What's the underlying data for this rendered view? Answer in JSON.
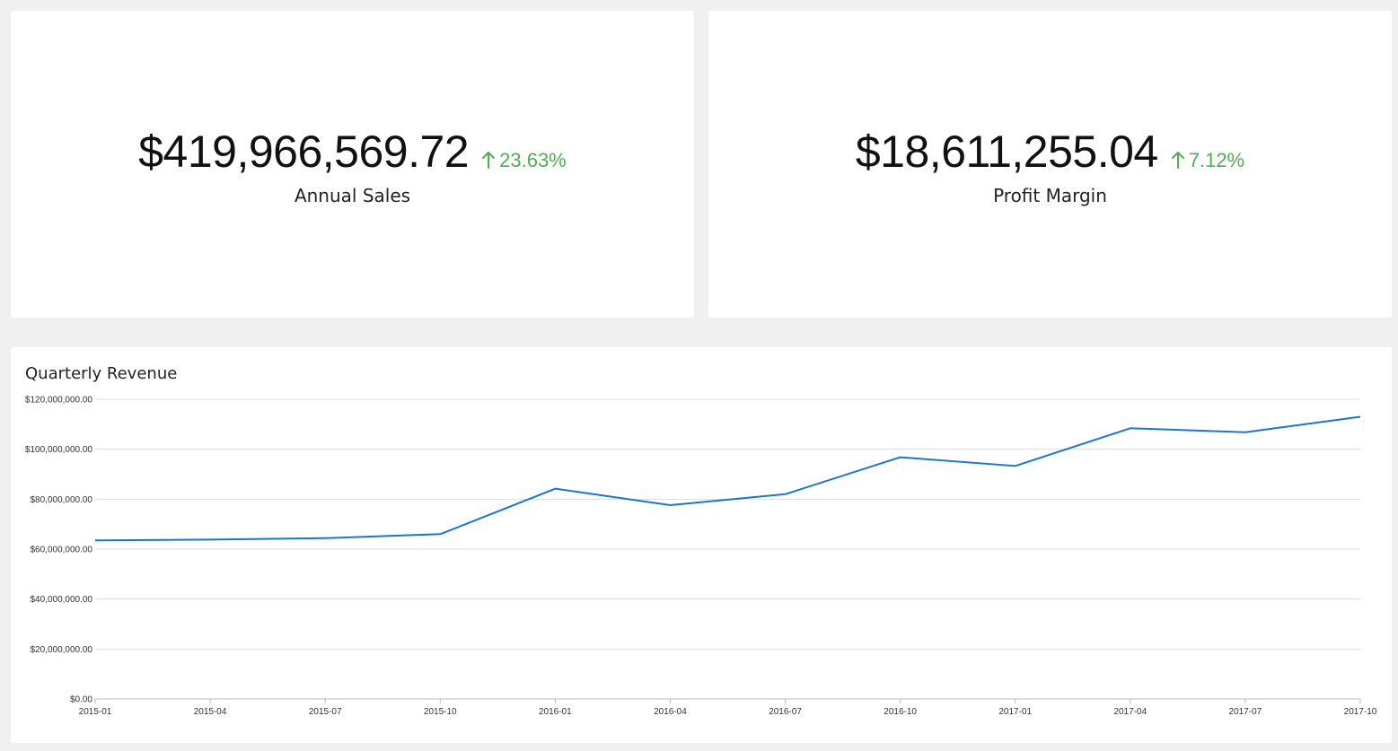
{
  "colors": {
    "background": "#f0f0f0",
    "card": "#ffffff",
    "positive": "#4caf50",
    "line": "#1976d2",
    "grid": "#dddddd"
  },
  "kpis": [
    {
      "value": "$419,966,569.72",
      "delta": "23.63%",
      "delta_icon": "arrow-up-icon",
      "label": "Annual Sales"
    },
    {
      "value": "$18,611,255.04",
      "delta": "7.12%",
      "delta_icon": "arrow-up-icon",
      "label": "Profit Margin"
    }
  ],
  "chart_data": {
    "type": "line",
    "title": "Quarterly Revenue",
    "xlabel": "",
    "ylabel": "",
    "categories": [
      "2015-01",
      "2015-04",
      "2015-07",
      "2015-10",
      "2016-01",
      "2016-04",
      "2016-07",
      "2016-10",
      "2017-01",
      "2017-04",
      "2017-07",
      "2017-10"
    ],
    "y_ticks": [
      "$0.00",
      "$20,000,000.00",
      "$40,000,000.00",
      "$60,000,000.00",
      "$80,000,000.00",
      "$100,000,000.00",
      "$120,000,000.00"
    ],
    "ylim": [
      0,
      120000000
    ],
    "grid": true,
    "series": [
      {
        "values": [
          63500000,
          63800000,
          64400000,
          66000000,
          84200000,
          77600000,
          82000000,
          96800000,
          93300000,
          108400000,
          106800000,
          113000000
        ]
      }
    ]
  }
}
